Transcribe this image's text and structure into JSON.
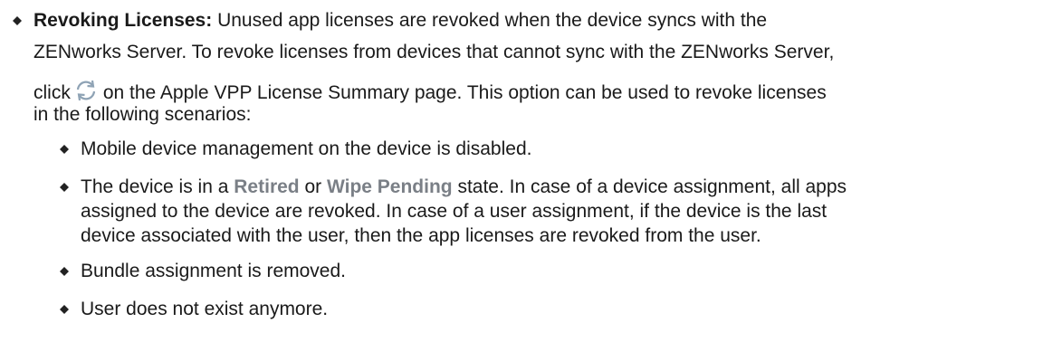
{
  "item": {
    "title": "Revoking Licenses:",
    "line1_rest": " Unused app licenses are revoked when the device syncs with the",
    "line2": "ZENworks Server. To revoke licenses from devices that cannot sync with the ZENworks Server,",
    "line3_before_icon": "click",
    "icon": "refresh-icon",
    "line3_after_icon": "on the Apple VPP License Summary page. This option can be used to revoke licenses",
    "line4": "in the following scenarios:"
  },
  "scenarios": {
    "s1": "Mobile device management on the device is disabled.",
    "s2_a": "The device is in a ",
    "s2_retired": "Retired",
    "s2_or": " or ",
    "s2_wipe": "Wipe Pending",
    "s2_b": " state. In case of a device assignment, all apps",
    "s2_line2": "assigned to the device are revoked. In case of a user assignment, if the device is the last",
    "s2_line3": "device associated with the user, then the app licenses are revoked from the user.",
    "s3": "Bundle assignment is removed.",
    "s4": "User does not exist anymore."
  },
  "colors": {
    "text": "#1a1a1a",
    "state_text": "#7a7f86",
    "bullet": "#222222",
    "icon": "#8fa3b5"
  }
}
